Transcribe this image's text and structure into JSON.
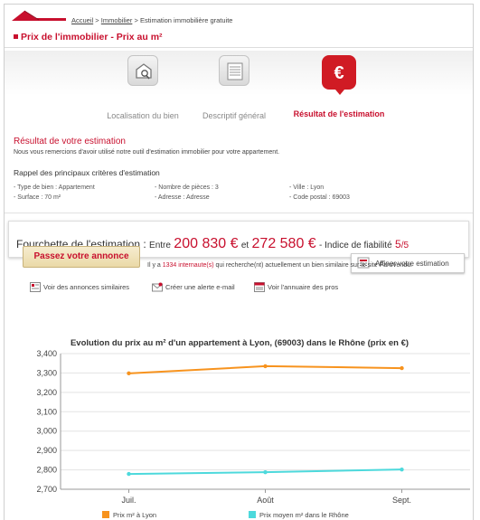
{
  "breadcrumb": {
    "home": "Accueil",
    "section": "Immobilier",
    "current": "Estimation immobilière gratuite",
    "sep": ">"
  },
  "page": {
    "title": "Prix de l'immobilier - Prix au m²"
  },
  "steps": [
    {
      "label": "Localisation du bien",
      "icon": "location-house-icon"
    },
    {
      "label": "Descriptif général",
      "icon": "document-icon"
    },
    {
      "label": "Résultat de l'estimation",
      "icon": "euro-icon",
      "active": true
    }
  ],
  "result": {
    "title": "Résultat de votre estimation",
    "text": "Nous vous remercions d'avoir utilisé notre outil d'estimation immobilier pour votre appartement.",
    "rappel_title": "Rappel des principaux critères d'estimation",
    "criteria": [
      "- Type de bien : Appartement",
      "- Nombre de pièces : 3",
      "- Ville : Lyon",
      "- Surface : 70 m²",
      "- Adresse : Adresse",
      "- Code postal : 69003"
    ]
  },
  "estimation": {
    "label": "Fourchette de l'estimation :",
    "entre": "Entre",
    "low": "200 830 €",
    "et": "et",
    "high": "272 580 €",
    "fiab_label": "- Indice de fiabilité",
    "fiab_value": "5",
    "fiab_max": "/5",
    "affiner": "Affiner votre estimation"
  },
  "annonce": {
    "button": "Passez votre annonce",
    "pre": "Il y a",
    "count": "1334 internaute(s)",
    "post": "qui recherche(nt) actuellement un bien similaire sur le site ParuVendu."
  },
  "links": [
    "Voir des annonces similaires",
    "Créer une alerte e-mail",
    "Voir l'annuaire des pros"
  ],
  "chart_data": {
    "type": "line",
    "title": "Evolution du prix au m² d'un appartement à Lyon, (69003) dans le Rhône (prix en €)",
    "categories": [
      "Juil.",
      "Août",
      "Sept."
    ],
    "ylim": [
      2700,
      3400
    ],
    "yticks": [
      "2,700",
      "2,800",
      "2,900",
      "3,000",
      "3,100",
      "3,200",
      "3,300",
      "3,400"
    ],
    "grid": true,
    "legend_position": "bottom",
    "series": [
      {
        "name": "Prix m² à Lyon",
        "values": [
          3298,
          3335,
          3325
        ],
        "color": "#f7931e"
      },
      {
        "name": "Prix moyen m² dans le Rhône",
        "values": [
          2779,
          2788,
          2802
        ],
        "color": "#4dd9dc"
      }
    ]
  }
}
